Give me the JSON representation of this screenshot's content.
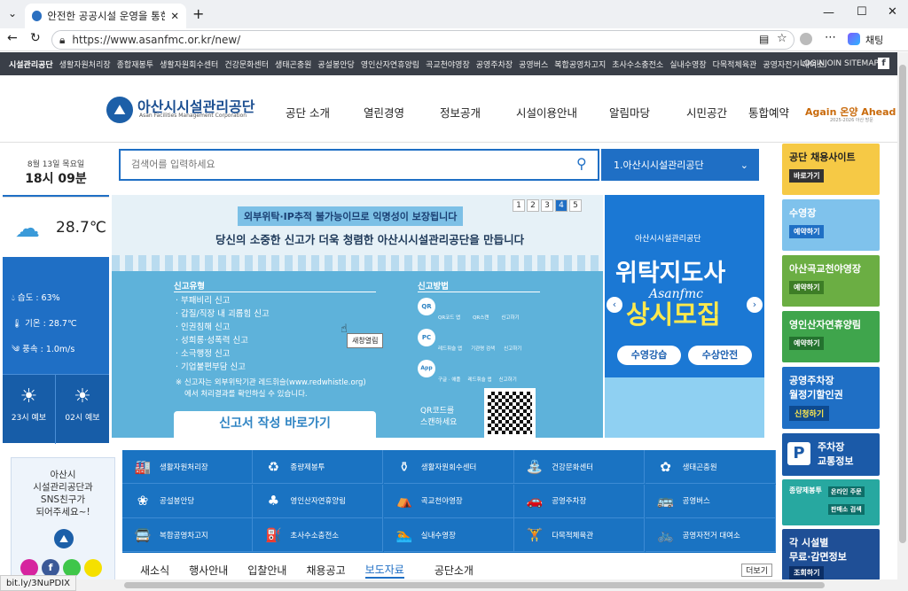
{
  "browser": {
    "tab_title": "안전한 공공시설 운영을 통한 시민",
    "url": "https://www.asanfmc.or.kr/new/",
    "chat_label": "채팅",
    "status_link": "bit.ly/3NuPDIX"
  },
  "topbar": {
    "items": [
      "시설관리공단",
      "생활자원처리장",
      "종합재봉투",
      "생활자원회수센터",
      "건강문화센터",
      "생태곤충원",
      "공설봉안당",
      "영인산자연휴양림",
      "곡교천야영장",
      "공영주차장",
      "공영버스",
      "복합공영차고지",
      "초사수소충전소",
      "실내수영장",
      "다목적체육관",
      "공영자전거 대여소"
    ],
    "right": [
      "LOGIN",
      "JOIN",
      "SITEMAP"
    ]
  },
  "header": {
    "logo_kr": "아산시시설관리공단",
    "logo_en": "Asan Facilities Management Corporation",
    "nav": [
      "공단 소개",
      "열린경영",
      "정보공개",
      "시설이용안내",
      "알림마당",
      "시민공간",
      "통합예약"
    ],
    "slogan": "Again 온양 Ahead 아",
    "slogan_sub": "2025-2026 아산 방문"
  },
  "weather": {
    "date": "8월 13일 목요일",
    "time": "18시 09분",
    "temp": "28.7℃",
    "humidity": "습도 : 63%",
    "temp_label": "기온 : 28.7℃",
    "wind": "풍속 : 1.0m/s",
    "fc1": "23시 예보",
    "fc2": "02시 예보"
  },
  "search": {
    "placeholder": "검색어를 입력하세요",
    "select": "1.아산시시설관리공단"
  },
  "banner": {
    "tag": "외부위탁·IP추적 불가능이므로 익명성이 보장됩니다",
    "headline": "당신의 소중한 신고가 더욱 청렴한 아산시시설관리공단을 만듭니다",
    "type_title": "신고유형",
    "types": [
      "· 부패비리 신고",
      "· 갑질/직장 내 괴롭힘 신고",
      "· 인권침해 신고",
      "· 성희롱·성폭력 신고",
      "· 소극행정 신고",
      "· 기업불편부담 신고"
    ],
    "note1": "※ 신고자는 외부위탁기관 레드휘슬(www.redwhistle.org)",
    "note2": "에서 처리결과를 확인하실 수 있습니다.",
    "method_title": "신고방법",
    "methods": [
      "QR코드 앱",
      "QR스캔",
      "신고하기",
      "레드휘슬 앱",
      "기관명 검색",
      "신고하기",
      "구글 · 애플",
      "레드휘슬 앱",
      "신고하기"
    ],
    "qr_text1": "QR코드를",
    "qr_text2": "스캔하세요",
    "button": "신고서 작성 바로가기",
    "tooltip": "새창열림",
    "pages": [
      "1",
      "2",
      "3",
      "4",
      "5"
    ]
  },
  "rbanner": {
    "org": "아산시시설관리공단",
    "title1": "위탁지도사",
    "title2": "상시모집",
    "script": "Asanfmc",
    "btn1": "수영강습",
    "btn2": "수상안전"
  },
  "side": {
    "b1": "공단 채용사이트",
    "b1s": "바로가기",
    "b2": "수영장",
    "b2s": "예약하기",
    "b3": "아산곡교천야영장",
    "b3s": "예약하기",
    "b4": "영인산자연휴양림",
    "b4s": "예약하기",
    "b5a": "공영주차장",
    "b5b": "월정기할인권",
    "b5s": "신청하기",
    "b6a": "주차장",
    "b6b": "교통정보",
    "b7": "종량제봉투",
    "b7a": "온라인 주문",
    "b7b": "판매소 검색",
    "b8a": "각 시설별",
    "b8b": "무료·감면정보",
    "b8s": "조회하기"
  },
  "sns": {
    "line1": "아산시",
    "line2": "시설관리공단과",
    "line3": "SNS친구가",
    "line4": "되어주세요~!"
  },
  "icons": [
    [
      "factory-icon",
      "생활자원처리장",
      "🏭"
    ],
    [
      "recycle-icon",
      "종량제봉투",
      "♻"
    ],
    [
      "bin-icon",
      "생활자원회수센터",
      "⚱"
    ],
    [
      "culture-icon",
      "건강문화센터",
      "⛲"
    ],
    [
      "butterfly-icon",
      "생태곤충원",
      "✿"
    ],
    [
      "flower-icon",
      "공설봉안당",
      "❀"
    ],
    [
      "tree-icon",
      "영인산자연휴양림",
      "♣"
    ],
    [
      "tent-icon",
      "곡교천야영장",
      "⛺"
    ],
    [
      "car-icon",
      "공영주차장",
      "🚗"
    ],
    [
      "bus-icon",
      "공영버스",
      "🚌"
    ],
    [
      "garage-icon",
      "복합공영차고지",
      "🚍"
    ],
    [
      "hydrogen-icon",
      "초사수소충전소",
      "⛽"
    ],
    [
      "swim-icon",
      "실내수영장",
      "🏊"
    ],
    [
      "gym-icon",
      "다목적체육관",
      "🏋"
    ],
    [
      "bike-icon",
      "공영자전거 대여소",
      "🚲"
    ]
  ],
  "tabs": [
    "새소식",
    "행사안내",
    "입찰안내",
    "채용공고",
    "보도자료"
  ],
  "notice": {
    "title": "공단소개",
    "more": "더보기"
  }
}
